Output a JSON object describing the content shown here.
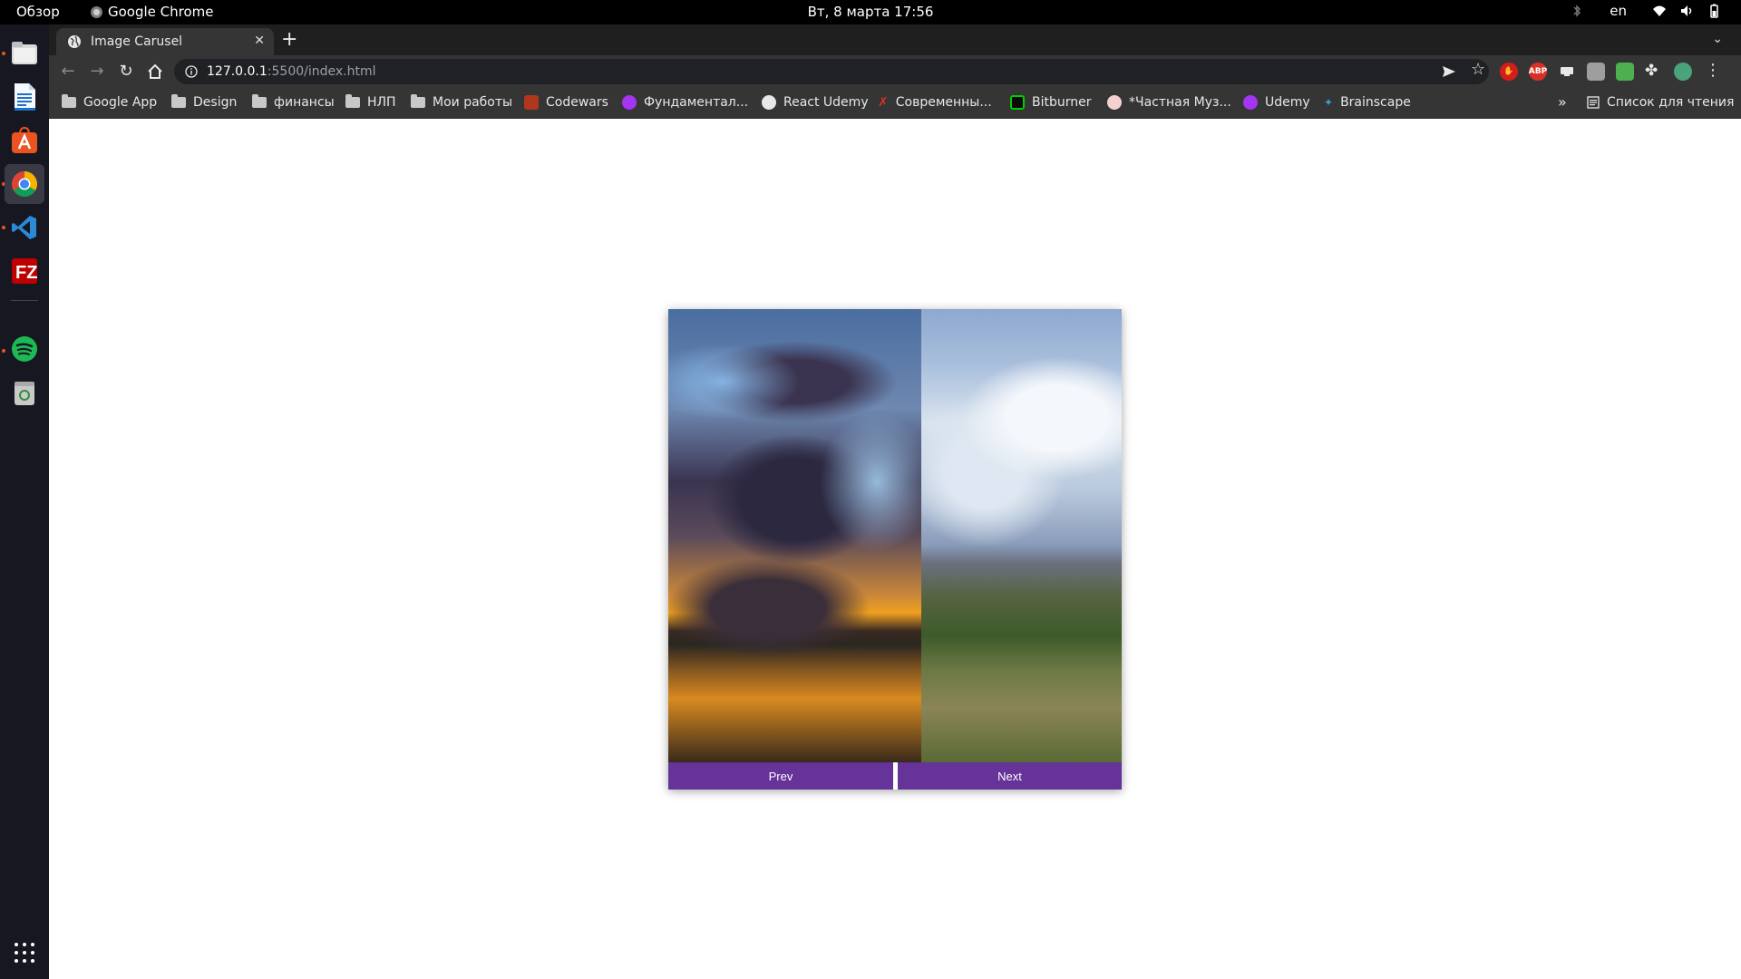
{
  "system": {
    "activities": "Обзор",
    "app_name": "Google Chrome",
    "clock": "Вт, 8 марта  17:56",
    "keyboard_layout": "en"
  },
  "dock": {
    "items": [
      {
        "name": "files-icon",
        "color": "#d9d9d9"
      },
      {
        "name": "writer-icon",
        "color": "#1e6fc8"
      },
      {
        "name": "app-center-icon",
        "color": "#e95420"
      },
      {
        "name": "chrome-icon",
        "color": "#4285f4"
      },
      {
        "name": "vscode-icon",
        "color": "#2a8ad8"
      },
      {
        "name": "filezilla-icon",
        "color": "#bf0000"
      },
      {
        "name": "spotify-icon",
        "color": "#1db954"
      },
      {
        "name": "trash-icon",
        "color": "#bdbdbd"
      }
    ]
  },
  "browser": {
    "tab_title": "Image Carusel",
    "url_host": "127.0.0.1",
    "url_path": ":5500/index.html",
    "bookmarks": [
      {
        "label": "Google App",
        "icon": "folder-icon"
      },
      {
        "label": "Design",
        "icon": "folder-icon"
      },
      {
        "label": "финансы",
        "icon": "folder-icon"
      },
      {
        "label": "НЛП",
        "icon": "folder-icon"
      },
      {
        "label": "Мои работы",
        "icon": "folder-icon"
      },
      {
        "label": "Codewars",
        "icon": "codewars-icon",
        "color": "#b1361e"
      },
      {
        "label": "Фундаментал...",
        "icon": "udemy-icon",
        "color": "#a435f0"
      },
      {
        "label": "React Udemy",
        "icon": "globe-icon",
        "color": "#e8e8e8"
      },
      {
        "label": "Современны...",
        "icon": "x-icon",
        "color": "#d93025"
      },
      {
        "label": "Bitburner",
        "icon": "bitburner-icon",
        "color": "#0c0"
      },
      {
        "label": "*Частная Муз...",
        "icon": "music-icon",
        "color": "#f2a0a0"
      },
      {
        "label": "Udemy",
        "icon": "udemy-icon",
        "color": "#a435f0"
      },
      {
        "label": "Brainscape",
        "icon": "brainscape-icon",
        "color": "#3b9bd6"
      }
    ],
    "more_bookmarks": "»",
    "reading_list": "Список для чтения"
  },
  "carousel": {
    "prev_label": "Prev",
    "next_label": "Next",
    "button_color": "#663399",
    "slides": [
      "sunset-clouds-image",
      "snowy-mountain-valley-image"
    ]
  }
}
